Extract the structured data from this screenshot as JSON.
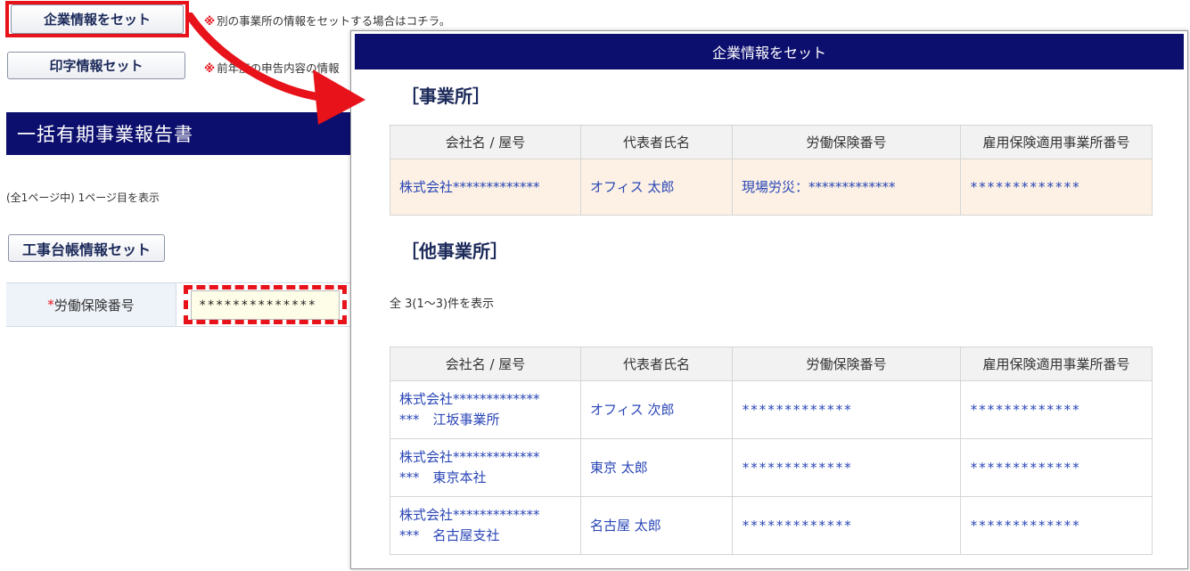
{
  "top_buttons": {
    "company_set": "企業情報をセット",
    "print_set": "印字情報セット",
    "koji_set": "工事台帳情報セット"
  },
  "notes": {
    "note1_mark": "※",
    "note1_text": "別の事業所の情報をセットする場合はコチラ。",
    "note2_mark": "※",
    "note2_text": "前年度の申告内容の情報"
  },
  "page": {
    "heading": "一括有期事業報告書",
    "pager": "(全1ページ中) 1ページ目を表示"
  },
  "form": {
    "required_mark": "*",
    "label": "労働保険番号",
    "value": "**************"
  },
  "colors": {
    "accent_navy": "#0d0f6e",
    "highlight_red": "#e8121b",
    "link_blue": "#2a46b6"
  },
  "modal": {
    "title": "企業情報をセット",
    "main_section": "［事業所］",
    "other_section": "［他事業所］",
    "count_text": "全 3(1〜3)件を表示",
    "columns": [
      "会社名 / 屋号",
      "代表者氏名",
      "労働保険番号",
      "雇用保険適用事業所番号"
    ],
    "main_rows": [
      {
        "company": "株式会社*************",
        "rep": "オフィス 太郎",
        "labor": "現場労災：*************",
        "employment": "*************"
      }
    ],
    "other_rows": [
      {
        "company_line1": "株式会社*************",
        "company_line2": "***　江坂事業所",
        "rep": "オフィス 次郎",
        "labor": "*************",
        "employment": "*************"
      },
      {
        "company_line1": "株式会社*************",
        "company_line2": "***　東京本社",
        "rep": "東京 太郎",
        "labor": "*************",
        "employment": "*************"
      },
      {
        "company_line1": "株式会社*************",
        "company_line2": "***　名古屋支社",
        "rep": "名古屋 太郎",
        "labor": "*************",
        "employment": "*************"
      }
    ]
  }
}
